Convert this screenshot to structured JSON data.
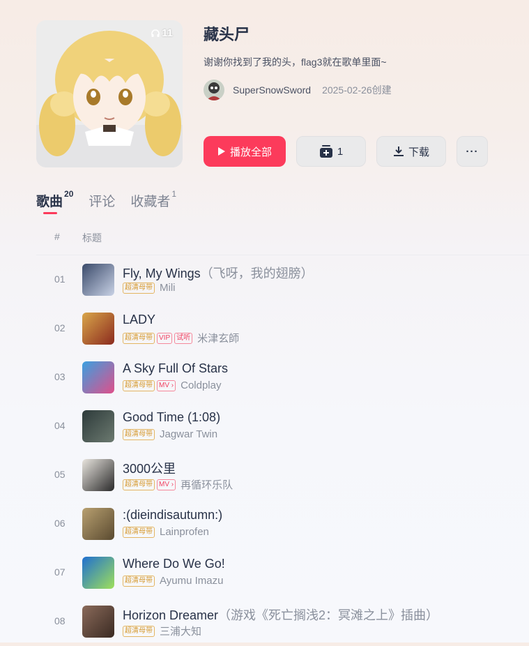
{
  "playlist": {
    "title": "藏头尸",
    "description": "谢谢你找到了我的头，flag3就在歌单里面~",
    "play_count": "11",
    "creator": "SuperSnowSword",
    "created": "2025-02-26创建"
  },
  "actions": {
    "play_all": "播放全部",
    "collect_count": "1",
    "download": "下载",
    "more": "···"
  },
  "tabs": [
    {
      "label": "歌曲",
      "count": "20"
    },
    {
      "label": "评论",
      "count": ""
    },
    {
      "label": "收藏者",
      "count": "1"
    }
  ],
  "table_header": {
    "num": "#",
    "title": "标题"
  },
  "songs": [
    {
      "index": "01",
      "title": "Fly, My Wings",
      "alias": "（飞呀，我的翅膀）",
      "tags": [
        "超清母带"
      ],
      "artist": "Mili",
      "thumb_colors": [
        "#3a4a6a",
        "#c9d2e6"
      ]
    },
    {
      "index": "02",
      "title": "LADY",
      "alias": "",
      "tags": [
        "超清母带",
        "VIP",
        "试听"
      ],
      "artist": "米津玄師",
      "thumb_colors": [
        "#d9a64a",
        "#8b2a1e"
      ]
    },
    {
      "index": "03",
      "title": "A Sky Full Of Stars",
      "alias": "",
      "tags": [
        "超清母带",
        "MV ›"
      ],
      "artist": "Coldplay",
      "thumb_colors": [
        "#3aa0e0",
        "#e04f8a"
      ]
    },
    {
      "index": "04",
      "title": "Good Time (1:08)",
      "alias": "",
      "tags": [
        "超清母带"
      ],
      "artist": "Jagwar Twin",
      "thumb_colors": [
        "#2d3a3a",
        "#6c7a70"
      ]
    },
    {
      "index": "05",
      "title": "3000公里",
      "alias": "",
      "tags": [
        "超清母带",
        "MV ›"
      ],
      "artist": "再循环乐队",
      "thumb_colors": [
        "#e8e4de",
        "#2a2a2a"
      ]
    },
    {
      "index": "06",
      "title": ":(dieindisautumn:)",
      "alias": "",
      "tags": [
        "超清母带"
      ],
      "artist": "Lainprofen",
      "thumb_colors": [
        "#b8a070",
        "#5a4a30"
      ]
    },
    {
      "index": "07",
      "title": "Where Do We Go!",
      "alias": "",
      "tags": [
        "超清母带"
      ],
      "artist": "Ayumu Imazu",
      "thumb_colors": [
        "#1f6fd0",
        "#9fe05a"
      ]
    },
    {
      "index": "08",
      "title": "Horizon Dreamer",
      "alias": "（游戏《死亡搁浅2：冥滩之上》插曲）",
      "tags": [
        "超清母带"
      ],
      "artist": "三浦大知",
      "thumb_colors": [
        "#8a6a5a",
        "#3a2a22"
      ]
    }
  ],
  "colors": {
    "accent": "#fc3b5b",
    "hq_tag": "#d69a2f",
    "red_tag": "#f04060"
  }
}
